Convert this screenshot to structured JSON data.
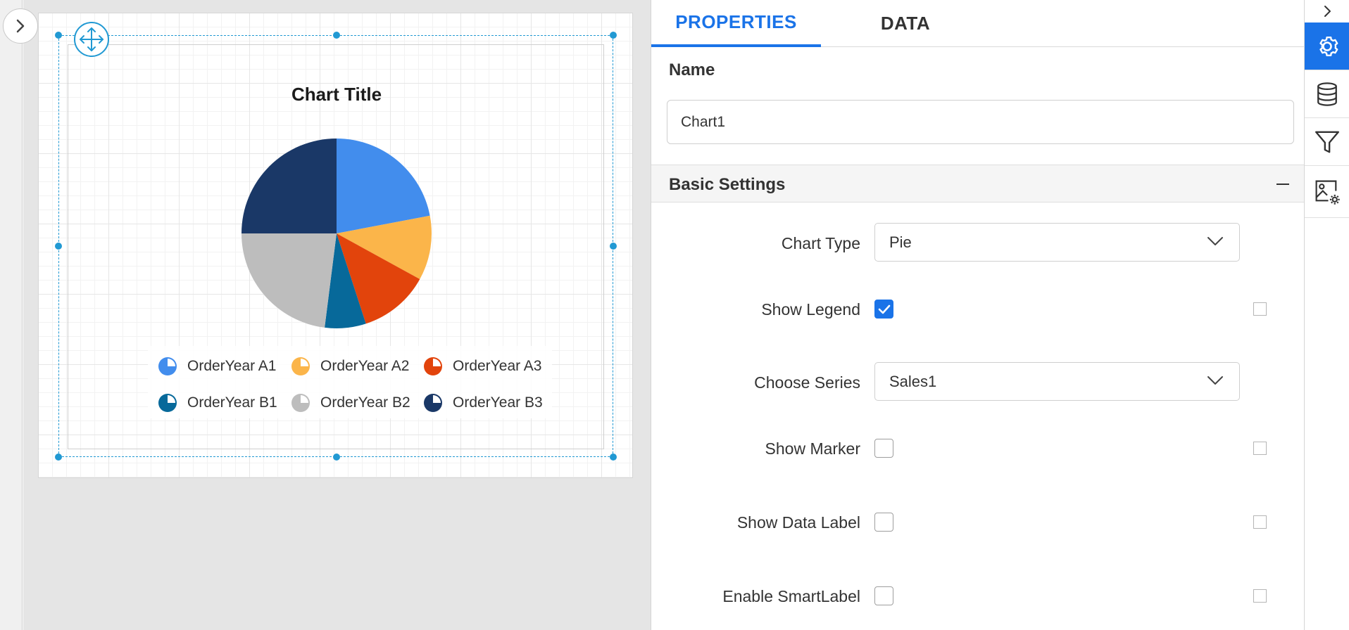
{
  "chart": {
    "title": "Chart Title"
  },
  "chart_data": {
    "type": "pie",
    "title": "Chart Title",
    "categories": [
      "OrderYear A1",
      "OrderYear A2",
      "OrderYear A3",
      "OrderYear B1",
      "OrderYear B2",
      "OrderYear B3"
    ],
    "values": [
      22,
      11,
      12,
      7,
      23,
      25
    ],
    "colors": [
      "#428ded",
      "#fbb54a",
      "#e2440c",
      "#07699a",
      "#bdbdbd",
      "#1a3867"
    ],
    "legend": "bottom"
  },
  "legend": {
    "items": [
      {
        "label": "OrderYear A1",
        "color": "#428ded"
      },
      {
        "label": "OrderYear A2",
        "color": "#fbb54a"
      },
      {
        "label": "OrderYear A3",
        "color": "#e2440c"
      },
      {
        "label": "OrderYear B1",
        "color": "#07699a"
      },
      {
        "label": "OrderYear B2",
        "color": "#bdbdbd"
      },
      {
        "label": "OrderYear B3",
        "color": "#1a3867"
      }
    ]
  },
  "panel": {
    "tabs": [
      {
        "label": "PROPERTIES"
      },
      {
        "label": "DATA"
      }
    ],
    "name_label": "Name",
    "name_value": "Chart1",
    "section_title": "Basic Settings",
    "chart_type_label": "Chart Type",
    "chart_type_value": "Pie",
    "show_legend_label": "Show Legend",
    "show_legend_checked": true,
    "choose_series_label": "Choose Series",
    "choose_series_value": "Sales1",
    "show_marker_label": "Show Marker",
    "show_marker_checked": false,
    "show_data_label_label": "Show Data Label",
    "show_data_label_checked": false,
    "enable_smartlabel_label": "Enable SmartLabel",
    "enable_smartlabel_checked": false
  },
  "toolbar": {
    "icons": [
      "chevron-right-icon",
      "gear-icon",
      "database-icon",
      "filter-icon",
      "image-settings-icon"
    ],
    "accent": "#1a73e8"
  },
  "colors": {
    "accent": "#1a73e8",
    "selection": "#2199d3"
  }
}
